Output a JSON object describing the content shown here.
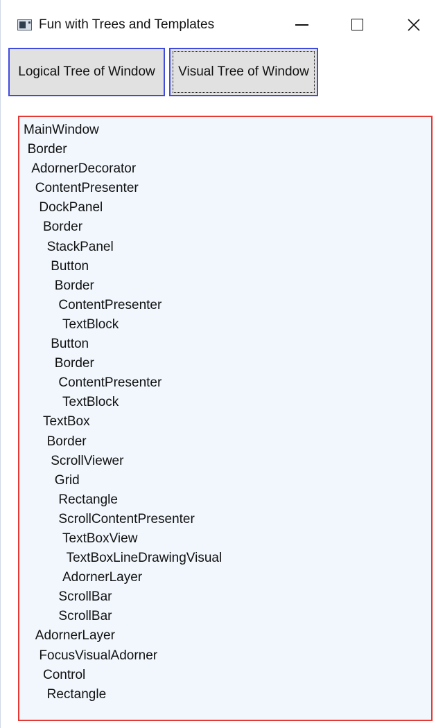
{
  "window": {
    "title": "Fun with Trees and Templates",
    "icon": "app-window-icon",
    "controls": {
      "minimize_icon": "minimize-icon",
      "maximize_icon": "maximize-icon",
      "close_icon": "close-icon"
    }
  },
  "toolbar": {
    "logical_label": "Logical Tree of Window",
    "visual_label": "Visual Tree of Window"
  },
  "colors": {
    "button_border": "#3f4bdc",
    "tree_border": "#e53935",
    "tree_background": "#f1f7fd"
  },
  "tree": {
    "items": [
      {
        "label": "MainWindow",
        "depth": 0
      },
      {
        "label": "Border",
        "depth": 1
      },
      {
        "label": "AdornerDecorator",
        "depth": 2
      },
      {
        "label": "ContentPresenter",
        "depth": 3
      },
      {
        "label": "DockPanel",
        "depth": 4
      },
      {
        "label": "Border",
        "depth": 5
      },
      {
        "label": "StackPanel",
        "depth": 6
      },
      {
        "label": "Button",
        "depth": 7
      },
      {
        "label": "Border",
        "depth": 8
      },
      {
        "label": "ContentPresenter",
        "depth": 9
      },
      {
        "label": "TextBlock",
        "depth": 10
      },
      {
        "label": "Button",
        "depth": 7
      },
      {
        "label": "Border",
        "depth": 8
      },
      {
        "label": "ContentPresenter",
        "depth": 9
      },
      {
        "label": "TextBlock",
        "depth": 10
      },
      {
        "label": "TextBox",
        "depth": 5
      },
      {
        "label": "Border",
        "depth": 6
      },
      {
        "label": "ScrollViewer",
        "depth": 7
      },
      {
        "label": "Grid",
        "depth": 8
      },
      {
        "label": "Rectangle",
        "depth": 9
      },
      {
        "label": "ScrollContentPresenter",
        "depth": 9
      },
      {
        "label": "TextBoxView",
        "depth": 10
      },
      {
        "label": "TextBoxLineDrawingVisual",
        "depth": 11
      },
      {
        "label": "AdornerLayer",
        "depth": 10
      },
      {
        "label": "ScrollBar",
        "depth": 9
      },
      {
        "label": "ScrollBar",
        "depth": 9
      },
      {
        "label": "AdornerLayer",
        "depth": 3
      },
      {
        "label": "FocusVisualAdorner",
        "depth": 4
      },
      {
        "label": "Control",
        "depth": 5
      },
      {
        "label": "Rectangle",
        "depth": 6
      }
    ]
  }
}
